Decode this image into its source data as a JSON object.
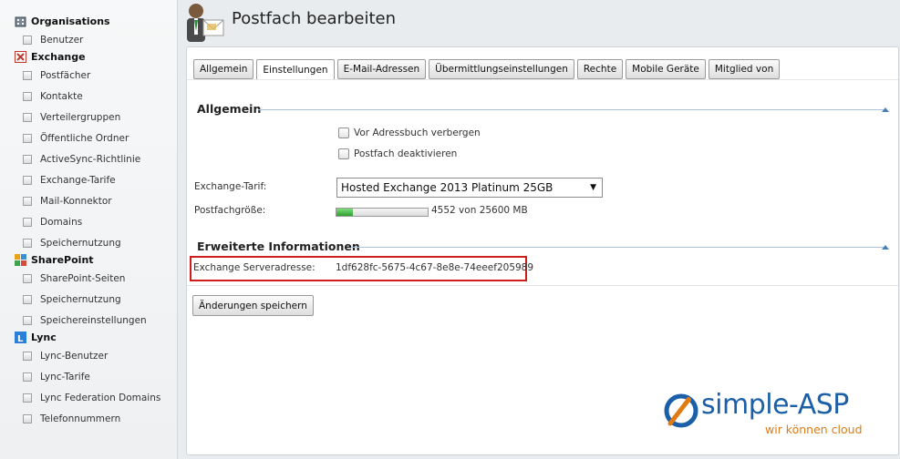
{
  "page": {
    "title": "Postfach bearbeiten"
  },
  "sidebar": {
    "categories": [
      {
        "label": "Organisations",
        "icon": "organisation-icon",
        "items": [
          {
            "label": "Benutzer"
          }
        ]
      },
      {
        "label": "Exchange",
        "icon": "exchange-icon",
        "items": [
          {
            "label": "Postfächer"
          },
          {
            "label": "Kontakte"
          },
          {
            "label": "Verteilergruppen"
          },
          {
            "label": "Öffentliche Ordner"
          },
          {
            "label": "ActiveSync-Richtlinie"
          },
          {
            "label": "Exchange-Tarife"
          },
          {
            "label": "Mail-Konnektor"
          },
          {
            "label": "Domains"
          },
          {
            "label": "Speichernutzung"
          }
        ]
      },
      {
        "label": "SharePoint",
        "icon": "sharepoint-icon",
        "items": [
          {
            "label": "SharePoint-Seiten"
          },
          {
            "label": "Speichernutzung"
          },
          {
            "label": "Speichereinstellungen"
          }
        ]
      },
      {
        "label": "Lync",
        "icon": "lync-icon",
        "items": [
          {
            "label": "Lync-Benutzer"
          },
          {
            "label": "Lync-Tarife"
          },
          {
            "label": "Lync Federation Domains"
          },
          {
            "label": "Telefonnummern"
          }
        ]
      }
    ]
  },
  "tabs": [
    {
      "label": "Allgemein",
      "active": false
    },
    {
      "label": "Einstellungen",
      "active": true
    },
    {
      "label": "E-Mail-Adressen",
      "active": false
    },
    {
      "label": "Übermittlungseinstellungen",
      "active": false
    },
    {
      "label": "Rechte",
      "active": false
    },
    {
      "label": "Mobile Geräte",
      "active": false
    },
    {
      "label": "Mitglied von",
      "active": false
    }
  ],
  "general": {
    "title": "Allgemein",
    "hide_from_addressbook": {
      "label": "Vor Adressbuch verbergen",
      "checked": false
    },
    "disable_mailbox": {
      "label": "Postfach deaktivieren",
      "checked": false
    },
    "plan_label": "Exchange-Tarif:",
    "plan_value": "Hosted Exchange 2013 Platinum 25GB",
    "size_label": "Postfachgröße:",
    "size_text": "4552 von 25600 MB",
    "size_used_fraction": 0.178
  },
  "extended": {
    "title": "Erweiterte Informationen",
    "server_label": "Exchange Serveradresse:",
    "server_value": "1df628fc-5675-4c67-8e8e-74eeef205989"
  },
  "actions": {
    "save_label": "Änderungen speichern"
  },
  "logo": {
    "name": "simple-ASP",
    "tagline": "wir können cloud"
  },
  "colors": {
    "accent": "#1b5fa8",
    "logo_orange": "#e07b13",
    "highlight_border": "#d11c1c",
    "progress_green": "#2ea02e"
  }
}
